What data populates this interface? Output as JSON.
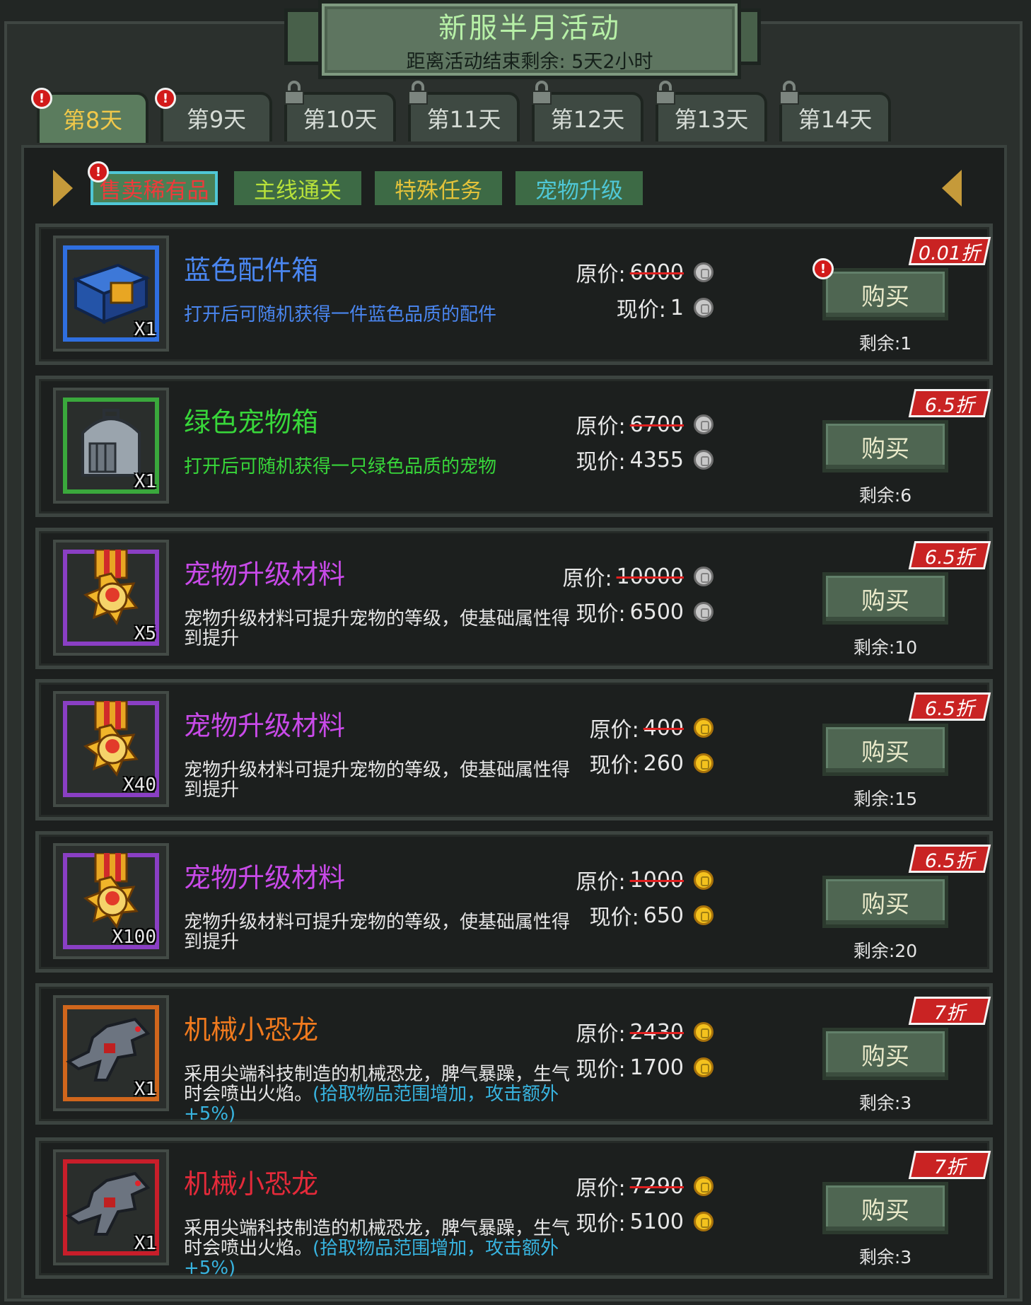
{
  "header": {
    "title": "新服半月活动",
    "subtitle": "距离活动结束剩余: 5天2小时"
  },
  "day_tabs": [
    {
      "label": "第8天",
      "active": true,
      "alert": true
    },
    {
      "label": "第9天",
      "active": false,
      "alert": true
    },
    {
      "label": "第10天",
      "locked": true
    },
    {
      "label": "第11天",
      "locked": true
    },
    {
      "label": "第12天",
      "locked": true
    },
    {
      "label": "第13天",
      "locked": true
    },
    {
      "label": "第14天",
      "locked": true
    }
  ],
  "categories": [
    {
      "label": "售卖稀有品",
      "active": true,
      "alert": true
    },
    {
      "label": "主线通关"
    },
    {
      "label": "特殊任务"
    },
    {
      "label": "宠物升级"
    }
  ],
  "labels": {
    "original_price": "原价:",
    "current_price": "现价:",
    "buy": "购买",
    "alert_mark": "!"
  },
  "items": [
    {
      "name": "蓝色配件箱",
      "name_color": "#4a86f0",
      "desc": "打开后可随机获得一件蓝色品质的配件",
      "desc_color": "#4a86f0",
      "desc_extra": "",
      "qty": "X1",
      "original": "6000",
      "current": "1",
      "currency": "silver",
      "discount": "0.01折",
      "remain": "剩余:1",
      "icon": "blue-part-box-icon",
      "bracket": "#2f6fe0",
      "alert": true
    },
    {
      "name": "绿色宠物箱",
      "name_color": "#38d63a",
      "desc": "打开后可随机获得一只绿色品质的宠物",
      "desc_color": "#38d63a",
      "desc_extra": "",
      "qty": "X1",
      "original": "6700",
      "current": "4355",
      "currency": "silver",
      "discount": "6.5折",
      "remain": "剩余:6",
      "icon": "pet-carrier-icon",
      "bracket": "#3aa83c"
    },
    {
      "name": "宠物升级材料",
      "name_color": "#c84ae8",
      "desc": "宠物升级材料可提升宠物的等级，使基础属性得到提升",
      "desc_color": "#e6e6e6",
      "desc_extra": "",
      "qty": "X5",
      "original": "10000",
      "current": "6500",
      "currency": "silver",
      "discount": "6.5折",
      "remain": "剩余:10",
      "icon": "pet-medal-icon",
      "bracket": "#8a3fc4"
    },
    {
      "name": "宠物升级材料",
      "name_color": "#c84ae8",
      "desc": "宠物升级材料可提升宠物的等级，使基础属性得到提升",
      "desc_color": "#e6e6e6",
      "desc_extra": "",
      "qty": "X40",
      "original": "400",
      "current": "260",
      "currency": "gold",
      "discount": "6.5折",
      "remain": "剩余:15",
      "icon": "pet-medal-icon",
      "bracket": "#8a3fc4"
    },
    {
      "name": "宠物升级材料",
      "name_color": "#c84ae8",
      "desc": "宠物升级材料可提升宠物的等级，使基础属性得到提升",
      "desc_color": "#e6e6e6",
      "desc_extra": "",
      "qty": "X100",
      "original": "1000",
      "current": "650",
      "currency": "gold",
      "discount": "6.5折",
      "remain": "剩余:20",
      "icon": "pet-medal-icon",
      "bracket": "#8a3fc4"
    },
    {
      "name": "机械小恐龙",
      "name_color": "#f07a1e",
      "desc": "采用尖端科技制造的机械恐龙，脾气暴躁，生气时会喷出火焰。",
      "desc_color": "#e6e6e6",
      "desc_extra": "(拾取物品范围增加，攻击额外+5%)",
      "qty": "X1",
      "original": "2430",
      "current": "1700",
      "currency": "gold",
      "discount": "7折",
      "remain": "剩余:3",
      "icon": "mech-dino-icon",
      "bracket": "#d0661c"
    },
    {
      "name": "机械小恐龙",
      "name_color": "#e42a3a",
      "desc": "采用尖端科技制造的机械恐龙，脾气暴躁，生气时会喷出火焰。",
      "desc_color": "#e6e6e6",
      "desc_extra": "(拾取物品范围增加，攻击额外+5%)",
      "qty": "X1",
      "original": "7290",
      "current": "5100",
      "currency": "gold",
      "discount": "7折",
      "remain": "剩余:3",
      "icon": "mech-dino-icon",
      "bracket": "#c81e2a"
    }
  ]
}
